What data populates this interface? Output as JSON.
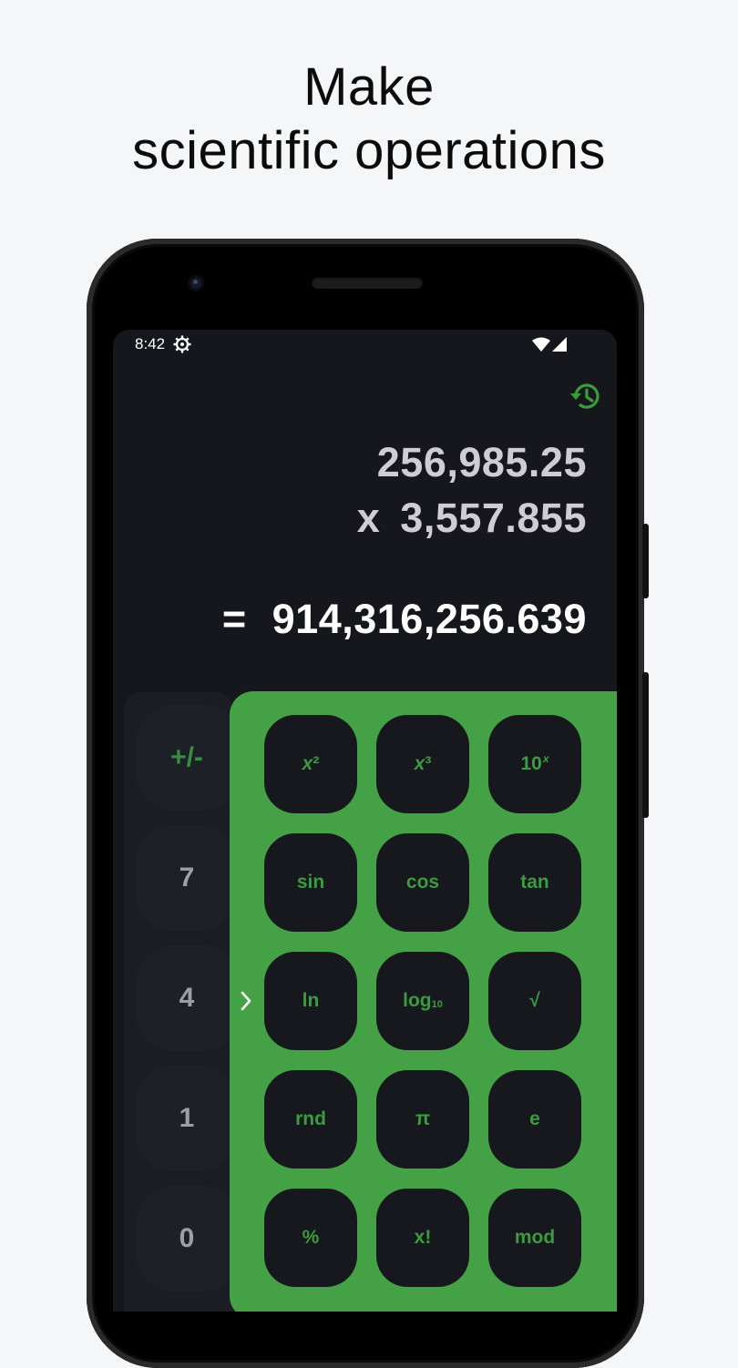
{
  "headline": {
    "line1": "Make",
    "line2": "scientific operations"
  },
  "status_bar": {
    "time": "8:42"
  },
  "display": {
    "operand1": "256,985.25",
    "operator": "x",
    "operand2": "3,557.855",
    "equals": "=",
    "result": "914,316,256.639"
  },
  "numpad": {
    "keys": [
      "+/-",
      "7",
      "4",
      "1",
      "0"
    ]
  },
  "scientific": {
    "row1": {
      "x2_base": "x",
      "x2_exp": "²",
      "x3_base": "x",
      "x3_exp": "³",
      "tenx_base": "10",
      "tenx_exp": "x"
    },
    "row2": [
      "sin",
      "cos",
      "tan"
    ],
    "row3": {
      "ln": "ln",
      "log_base": "log",
      "log_sub": "10",
      "sqrt": "√"
    },
    "row4": [
      "rnd",
      "π",
      "e"
    ],
    "row5": [
      "%",
      "x!",
      "mod"
    ]
  },
  "colors": {
    "accent_green": "#45a145",
    "key_text_green": "#3a9b3f",
    "screen_bg": "#15171c"
  }
}
